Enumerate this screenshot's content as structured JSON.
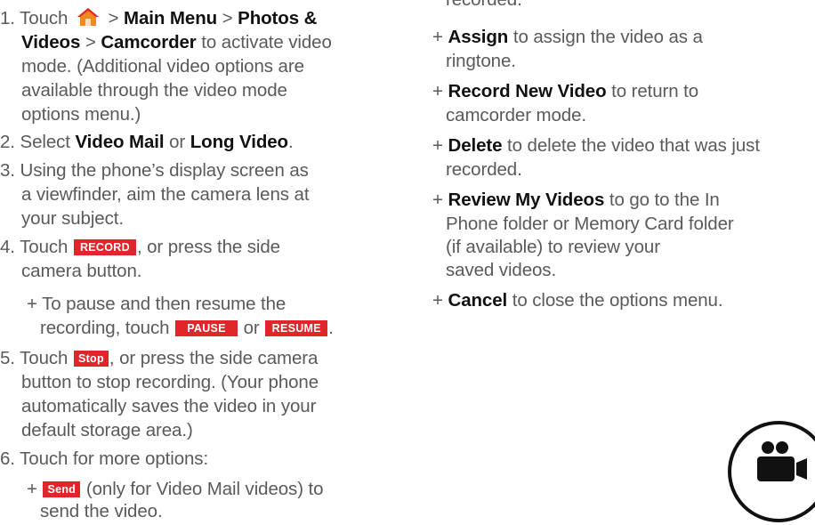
{
  "colors": {
    "accent_red": "#e0262a",
    "body_text": "#5a5a5a",
    "bold_text": "#111111"
  },
  "left": {
    "step1": {
      "a": "1. Touch",
      "b": ">",
      "c": "Main Menu",
      "d": ">",
      "e": "Photos &",
      "f": "Videos",
      "g": ">",
      "h": "Camcorder",
      "i": "to activate video",
      "j": "mode. (Additional video options are",
      "k": "available through the video mode",
      "l": "options menu.)"
    },
    "step2": {
      "a": "2. Select",
      "b": "Video Mail",
      "c": "or",
      "d": "Long Video",
      "e": "."
    },
    "step3": {
      "a": "3. Using the phone’s display screen as",
      "b": "a viewfinder, aim the camera lens at",
      "c": "your subject."
    },
    "step4": {
      "a": "4. Touch",
      "chip": "RECORD",
      "b": ", or press the side",
      "c": "camera button."
    },
    "sub4": {
      "a": "+ To pause and then resume the",
      "b": "recording, touch",
      "pause": "PAUSE",
      "or": "or",
      "resume": "RESUME",
      "end": "."
    },
    "step5": {
      "a": "5. Touch",
      "chip": "Stop",
      "b": ", or press the side camera",
      "c": "button to stop recording. (Your phone",
      "d": "automatically saves the video in your",
      "e": "default storage area.)"
    },
    "step6": "6. Touch for more options:",
    "sub6": {
      "plus": "+",
      "chip": "Send",
      "a": "(only for Video Mail videos) to",
      "b": "send the video."
    }
  },
  "right": {
    "top": "recorded.",
    "assign": {
      "plus": "+",
      "b": "Assign",
      "a": "to assign the video as a",
      "c": "ringtone."
    },
    "record": {
      "plus": "+",
      "b": "Record New Video",
      "a": "to return to",
      "c": "camcorder mode."
    },
    "delete": {
      "plus": "+",
      "b": "Delete",
      "a": "to delete the video that was just",
      "c": "recorded."
    },
    "review": {
      "plus": "+",
      "b": "Review My Videos",
      "a": "to go to the In",
      "c": "Phone folder or Memory Card folder",
      "d": "(if available) to review your",
      "e": "saved videos."
    },
    "cancel": {
      "plus": "+",
      "b": "Cancel",
      "a": "to close the options menu."
    }
  },
  "icons": {
    "home": "home-icon",
    "camcorder": "camcorder-icon"
  }
}
